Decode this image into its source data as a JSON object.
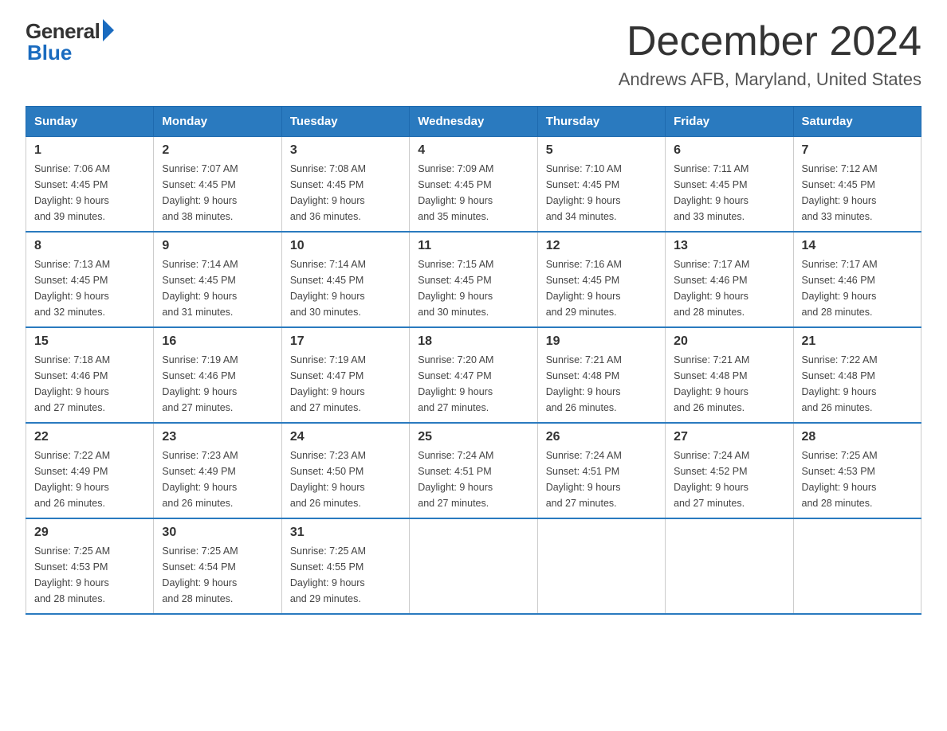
{
  "header": {
    "logo_general": "General",
    "logo_blue": "Blue",
    "main_title": "December 2024",
    "subtitle": "Andrews AFB, Maryland, United States"
  },
  "calendar": {
    "days_of_week": [
      "Sunday",
      "Monday",
      "Tuesday",
      "Wednesday",
      "Thursday",
      "Friday",
      "Saturday"
    ],
    "weeks": [
      [
        {
          "day": "1",
          "sunrise": "7:06 AM",
          "sunset": "4:45 PM",
          "daylight": "9 hours and 39 minutes."
        },
        {
          "day": "2",
          "sunrise": "7:07 AM",
          "sunset": "4:45 PM",
          "daylight": "9 hours and 38 minutes."
        },
        {
          "day": "3",
          "sunrise": "7:08 AM",
          "sunset": "4:45 PM",
          "daylight": "9 hours and 36 minutes."
        },
        {
          "day": "4",
          "sunrise": "7:09 AM",
          "sunset": "4:45 PM",
          "daylight": "9 hours and 35 minutes."
        },
        {
          "day": "5",
          "sunrise": "7:10 AM",
          "sunset": "4:45 PM",
          "daylight": "9 hours and 34 minutes."
        },
        {
          "day": "6",
          "sunrise": "7:11 AM",
          "sunset": "4:45 PM",
          "daylight": "9 hours and 33 minutes."
        },
        {
          "day": "7",
          "sunrise": "7:12 AM",
          "sunset": "4:45 PM",
          "daylight": "9 hours and 33 minutes."
        }
      ],
      [
        {
          "day": "8",
          "sunrise": "7:13 AM",
          "sunset": "4:45 PM",
          "daylight": "9 hours and 32 minutes."
        },
        {
          "day": "9",
          "sunrise": "7:14 AM",
          "sunset": "4:45 PM",
          "daylight": "9 hours and 31 minutes."
        },
        {
          "day": "10",
          "sunrise": "7:14 AM",
          "sunset": "4:45 PM",
          "daylight": "9 hours and 30 minutes."
        },
        {
          "day": "11",
          "sunrise": "7:15 AM",
          "sunset": "4:45 PM",
          "daylight": "9 hours and 30 minutes."
        },
        {
          "day": "12",
          "sunrise": "7:16 AM",
          "sunset": "4:45 PM",
          "daylight": "9 hours and 29 minutes."
        },
        {
          "day": "13",
          "sunrise": "7:17 AM",
          "sunset": "4:46 PM",
          "daylight": "9 hours and 28 minutes."
        },
        {
          "day": "14",
          "sunrise": "7:17 AM",
          "sunset": "4:46 PM",
          "daylight": "9 hours and 28 minutes."
        }
      ],
      [
        {
          "day": "15",
          "sunrise": "7:18 AM",
          "sunset": "4:46 PM",
          "daylight": "9 hours and 27 minutes."
        },
        {
          "day": "16",
          "sunrise": "7:19 AM",
          "sunset": "4:46 PM",
          "daylight": "9 hours and 27 minutes."
        },
        {
          "day": "17",
          "sunrise": "7:19 AM",
          "sunset": "4:47 PM",
          "daylight": "9 hours and 27 minutes."
        },
        {
          "day": "18",
          "sunrise": "7:20 AM",
          "sunset": "4:47 PM",
          "daylight": "9 hours and 27 minutes."
        },
        {
          "day": "19",
          "sunrise": "7:21 AM",
          "sunset": "4:48 PM",
          "daylight": "9 hours and 26 minutes."
        },
        {
          "day": "20",
          "sunrise": "7:21 AM",
          "sunset": "4:48 PM",
          "daylight": "9 hours and 26 minutes."
        },
        {
          "day": "21",
          "sunrise": "7:22 AM",
          "sunset": "4:48 PM",
          "daylight": "9 hours and 26 minutes."
        }
      ],
      [
        {
          "day": "22",
          "sunrise": "7:22 AM",
          "sunset": "4:49 PM",
          "daylight": "9 hours and 26 minutes."
        },
        {
          "day": "23",
          "sunrise": "7:23 AM",
          "sunset": "4:49 PM",
          "daylight": "9 hours and 26 minutes."
        },
        {
          "day": "24",
          "sunrise": "7:23 AM",
          "sunset": "4:50 PM",
          "daylight": "9 hours and 26 minutes."
        },
        {
          "day": "25",
          "sunrise": "7:24 AM",
          "sunset": "4:51 PM",
          "daylight": "9 hours and 27 minutes."
        },
        {
          "day": "26",
          "sunrise": "7:24 AM",
          "sunset": "4:51 PM",
          "daylight": "9 hours and 27 minutes."
        },
        {
          "day": "27",
          "sunrise": "7:24 AM",
          "sunset": "4:52 PM",
          "daylight": "9 hours and 27 minutes."
        },
        {
          "day": "28",
          "sunrise": "7:25 AM",
          "sunset": "4:53 PM",
          "daylight": "9 hours and 28 minutes."
        }
      ],
      [
        {
          "day": "29",
          "sunrise": "7:25 AM",
          "sunset": "4:53 PM",
          "daylight": "9 hours and 28 minutes."
        },
        {
          "day": "30",
          "sunrise": "7:25 AM",
          "sunset": "4:54 PM",
          "daylight": "9 hours and 28 minutes."
        },
        {
          "day": "31",
          "sunrise": "7:25 AM",
          "sunset": "4:55 PM",
          "daylight": "9 hours and 29 minutes."
        },
        null,
        null,
        null,
        null
      ]
    ],
    "labels": {
      "sunrise": "Sunrise:",
      "sunset": "Sunset:",
      "daylight": "Daylight:"
    }
  }
}
